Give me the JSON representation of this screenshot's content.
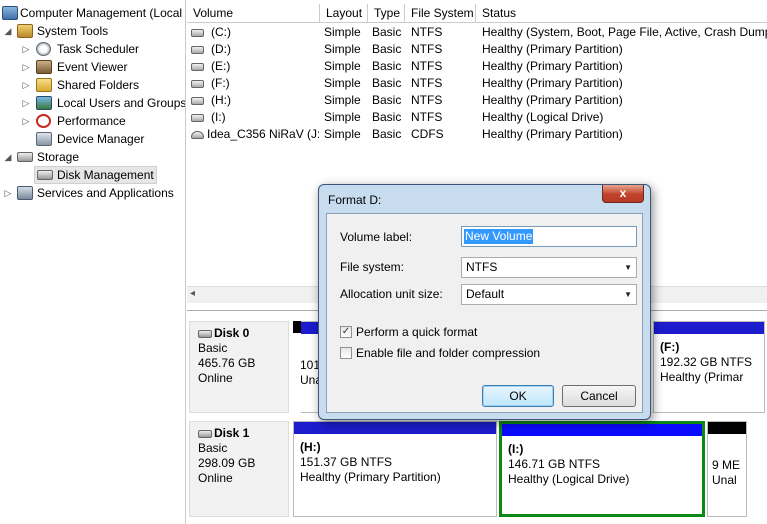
{
  "tree": {
    "items": [
      {
        "label": "Computer Management (Local",
        "icon": "computer-icon",
        "expander": ""
      },
      {
        "label": "System Tools",
        "icon": "tools-icon",
        "expander": "◢"
      },
      {
        "label": "Task Scheduler",
        "icon": "clock-icon",
        "expander": "▷"
      },
      {
        "label": "Event Viewer",
        "icon": "event-viewer-icon",
        "expander": "▷"
      },
      {
        "label": "Shared Folders",
        "icon": "shared-folder-icon",
        "expander": "▷"
      },
      {
        "label": "Local Users and Groups",
        "icon": "users-icon",
        "expander": "▷"
      },
      {
        "label": "Performance",
        "icon": "performance-icon",
        "expander": "▷"
      },
      {
        "label": "Device Manager",
        "icon": "device-manager-icon",
        "expander": ""
      },
      {
        "label": "Storage",
        "icon": "storage-icon",
        "expander": "◢"
      },
      {
        "label": "Disk Management",
        "icon": "disk-icon",
        "expander": ""
      },
      {
        "label": "Services and Applications",
        "icon": "services-icon",
        "expander": "▷"
      }
    ]
  },
  "volumes": {
    "columns": [
      "Volume",
      "Layout",
      "Type",
      "File System",
      "Status"
    ],
    "rows": [
      {
        "volume": "(C:)",
        "layout": "Simple",
        "type": "Basic",
        "fs": "NTFS",
        "status": "Healthy (System, Boot, Page File, Active, Crash Dump,"
      },
      {
        "volume": "(D:)",
        "layout": "Simple",
        "type": "Basic",
        "fs": "NTFS",
        "status": "Healthy (Primary Partition)"
      },
      {
        "volume": "(E:)",
        "layout": "Simple",
        "type": "Basic",
        "fs": "NTFS",
        "status": "Healthy (Primary Partition)"
      },
      {
        "volume": "(F:)",
        "layout": "Simple",
        "type": "Basic",
        "fs": "NTFS",
        "status": "Healthy (Primary Partition)"
      },
      {
        "volume": "(H:)",
        "layout": "Simple",
        "type": "Basic",
        "fs": "NTFS",
        "status": "Healthy (Primary Partition)"
      },
      {
        "volume": "(I:)",
        "layout": "Simple",
        "type": "Basic",
        "fs": "NTFS",
        "status": "Healthy (Logical Drive)"
      },
      {
        "volume": "Idea_C356 NiRaV (J:)",
        "layout": "Simple",
        "type": "Basic",
        "fs": "CDFS",
        "status": "Healthy (Primary Partition)"
      }
    ]
  },
  "disks": [
    {
      "name": "Disk 0",
      "kind": "Basic",
      "size": "465.76 GB",
      "state": "Online",
      "partitions": [
        {
          "title": "",
          "size": "101",
          "status": "Una"
        },
        {
          "title": "(F:)",
          "size": "192.32 GB NTFS",
          "status": "Healthy (Primar"
        }
      ]
    },
    {
      "name": "Disk 1",
      "kind": "Basic",
      "size": "298.09 GB",
      "state": "Online",
      "partitions": [
        {
          "title": "(H:)",
          "size": "151.37 GB NTFS",
          "status": "Healthy (Primary Partition)"
        },
        {
          "title": "(I:)",
          "size": "146.71 GB NTFS",
          "status": "Healthy (Logical Drive)"
        },
        {
          "title": "",
          "size": "9 ME",
          "status": "Unal"
        }
      ]
    }
  ],
  "dialog": {
    "title": "Format D:",
    "close_label": "x",
    "volume_label_caption": "Volume label:",
    "volume_label_value": "New Volume",
    "file_system_caption": "File system:",
    "file_system_value": "NTFS",
    "alloc_caption": "Allocation unit size:",
    "alloc_value": "Default",
    "quick_format_label": "Perform a quick format",
    "quick_format_checked": true,
    "compression_label": "Enable file and folder compression",
    "compression_checked": false,
    "ok_label": "OK",
    "cancel_label": "Cancel"
  },
  "colors": {
    "primary_partition_bar": "#1c1ccc",
    "logical_bar": "#0a0aff",
    "unallocated_bar": "#000000",
    "selection_border": "#0a8a14",
    "dialog_frame": "#c8dcf0"
  }
}
